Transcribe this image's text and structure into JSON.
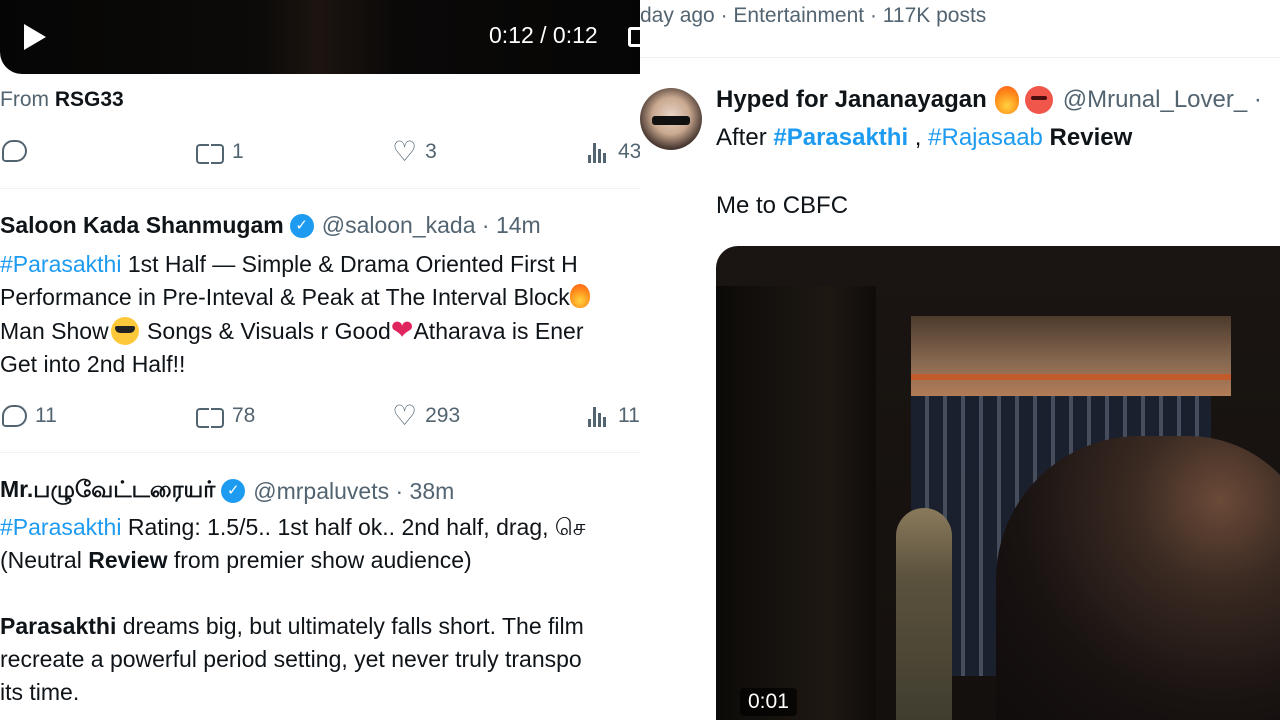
{
  "left": {
    "top_video": {
      "time": "0:12 / 0:12"
    },
    "from": {
      "prefix": "From",
      "source": "RSG33"
    },
    "actions1": {
      "retweets": "1",
      "likes": "3",
      "views": "43"
    },
    "tweet1": {
      "name": "Saloon Kada Shanmugam",
      "handle": "@saloon_kada · 14m",
      "hashtag": "#Parasakthi",
      "line1": " 1st Half — Simple & Drama Oriented First H",
      "line2": "Performance in Pre-Inteval & Peak at The Interval Block",
      "line3a": "Man Show",
      "line3b": " Songs & Visuals r Good",
      "line3c": "Atharava is Ener",
      "line4": "Get into 2nd Half!!",
      "replies": "11",
      "retweets": "78",
      "likes": "293",
      "views": "11"
    },
    "tweet2": {
      "name": "Mr.பழுவேட்டரையர்",
      "handle": "@mrpaluvets · 38m",
      "hashtag": "#Parasakthi",
      "line1": " Rating: 1.5/5.. 1st half ok.. 2nd half, drag, செ",
      "line2a": "(Neutral ",
      "line2b": "Review",
      "line2c": " from premier show audience)",
      "line3a": "Parasakthi",
      "line3b": " dreams big, but ultimately falls short. The film",
      "line4": "recreate a powerful period setting, yet never truly transpo",
      "line5": "its time."
    }
  },
  "right": {
    "trend": "day ago · Entertainment · 117K posts",
    "tweet": {
      "name": "Hyped for Jananayagan",
      "handle": "@Mrunal_Lover_ ·",
      "after": "After ",
      "tag1": "#Parasakthi",
      "sep": " , ",
      "tag2": "#Rajasaab",
      "review": " Review",
      "line2": "Me to CBFC",
      "video_time": "0:01"
    }
  }
}
